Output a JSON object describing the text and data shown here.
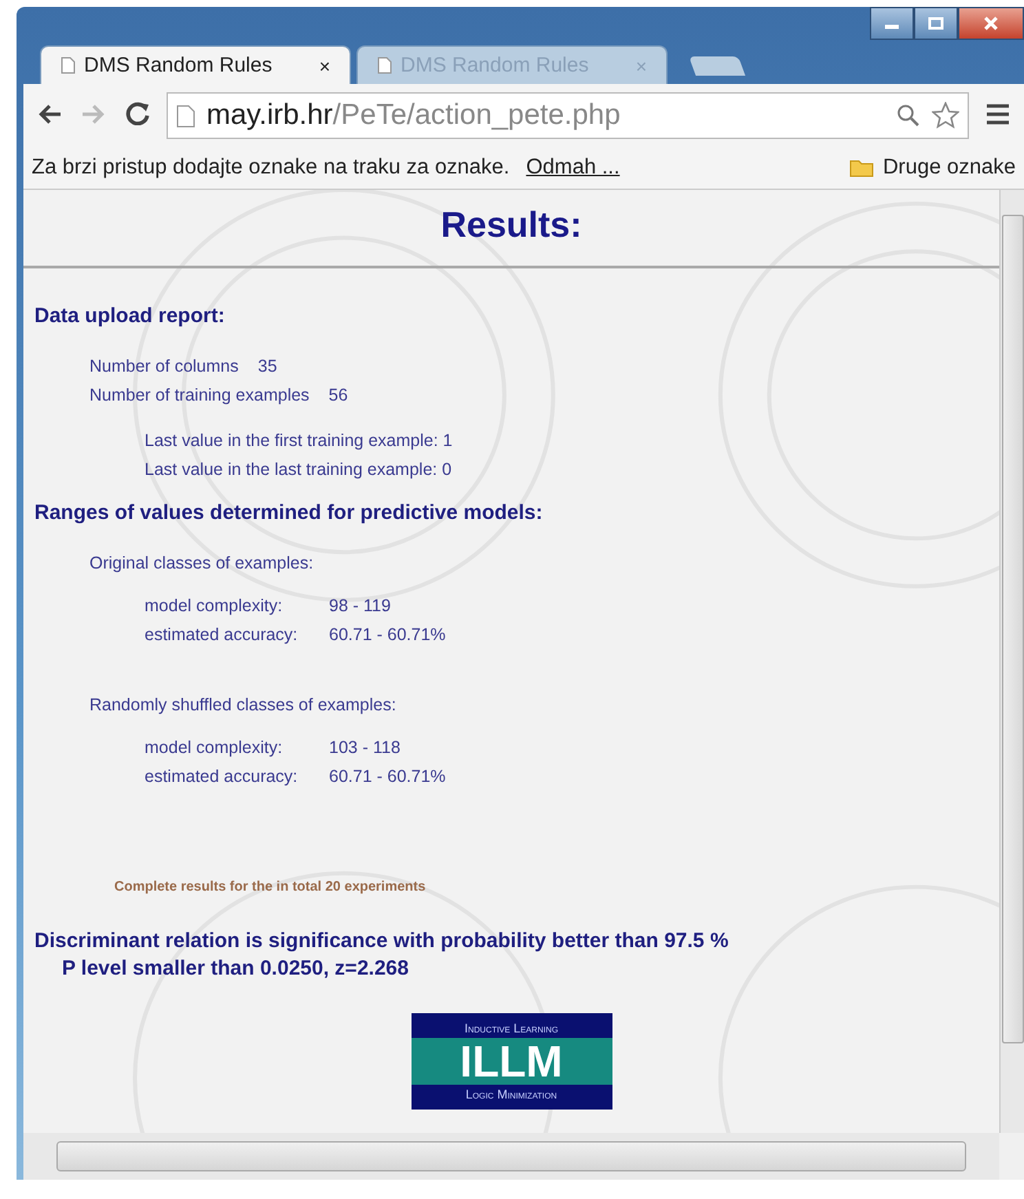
{
  "tabs": [
    {
      "title": "DMS Random Rules",
      "close": "×",
      "selected": true
    },
    {
      "title": "DMS Random Rules",
      "close": "×",
      "selected": false
    }
  ],
  "address": {
    "host": "may.irb.hr",
    "path": "/PeTe/action_pete.php"
  },
  "bookmarks_bar": {
    "hint": "Za brzi pristup dodajte oznake na traku za oznake.",
    "link": "Odmah ...",
    "folder": "Druge oznake"
  },
  "page": {
    "title": "Results:",
    "upload": {
      "heading": "Data upload report:",
      "stats": [
        {
          "label": "Number of columns",
          "value": "35"
        },
        {
          "label": "Number of training examples",
          "value": "56"
        }
      ],
      "last_values": [
        "Last value in the first training example: 1",
        "Last value in the last training example: 0"
      ]
    },
    "ranges": {
      "heading": "Ranges of values determined for predictive models:",
      "groups": [
        {
          "title": "Original classes of examples:",
          "rows": [
            {
              "label": "model complexity:",
              "value": "98 - 119"
            },
            {
              "label": "estimated accuracy:",
              "value": "60.71 - 60.71%"
            }
          ]
        },
        {
          "title": "Randomly shuffled classes of examples:",
          "rows": [
            {
              "label": "model complexity:",
              "value": "103 - 118"
            },
            {
              "label": "estimated accuracy:",
              "value": "60.71 - 60.71%"
            }
          ]
        }
      ]
    },
    "results_link": "Complete results for the in total 20 experiments",
    "conclusion": [
      "Discriminant relation is significance with probability better than 97.5 %",
      "P level smaller than 0.0250, z=2.268"
    ],
    "logo": {
      "top": "Inductive Learning",
      "main": "ILLM",
      "bottom": "Logic Minimization"
    }
  }
}
